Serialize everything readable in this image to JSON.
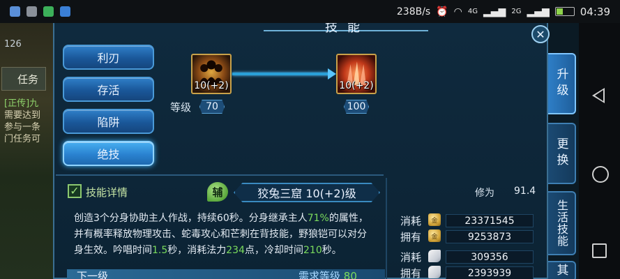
{
  "status_bar": {
    "net_speed": "238B/s",
    "battery": "9",
    "time": "04:39",
    "signal_1": "4G",
    "signal_2": "2G"
  },
  "background_hud": {
    "number": "126",
    "task_button": "任务",
    "task_lines": [
      "[正传]九",
      "需要达到",
      "参与一条",
      "门任务可"
    ]
  },
  "panel": {
    "title": "技能",
    "close_label": "✕"
  },
  "tabs": [
    {
      "label": "利刃",
      "active": false
    },
    {
      "label": "存活",
      "active": false
    },
    {
      "label": "陷阱",
      "active": false
    },
    {
      "label": "绝技",
      "active": true
    }
  ],
  "upgrade": {
    "level_label": "等级",
    "current": {
      "icon_level": "10(+2)",
      "level": "70"
    },
    "next": {
      "icon_level": "10(+2)",
      "level": "100"
    }
  },
  "details": {
    "header": "技能详情",
    "aux_badge": "辅",
    "skill_name": "狡兔三窟 10(+2)级",
    "desc_parts": [
      "创造3个分身协助主人作战，持续60秒。分身继承主人",
      "71%",
      "的属性，并有概率释放物理攻击、蛇毒攻心和芒刺在背技能，野狼铠可以对分身生效。吟唱时间",
      "1.5",
      "秒，消耗法力",
      "234",
      "点，冷却时间",
      "210",
      "秒。"
    ],
    "next_label": "下一级",
    "req_label": "需求等级",
    "req_value": "80"
  },
  "stats": {
    "xiuwei_label": "修为",
    "xiuwei_value": "91.4",
    "rows": [
      {
        "label": "消耗",
        "value": "23371545",
        "icon": "gold-coin-icon"
      },
      {
        "label": "拥有",
        "value": "9253873",
        "icon": "gold-coin-icon"
      },
      {
        "label": "消耗",
        "value": "309356",
        "icon": "scroll-icon"
      },
      {
        "label": "拥有",
        "value": "2393939",
        "icon": "scroll-icon"
      }
    ]
  },
  "side_tabs": [
    {
      "label": "升级",
      "active": true
    },
    {
      "label": "更换",
      "active": false
    },
    {
      "label": "生活技能",
      "active": false
    },
    {
      "label": "其",
      "active": false
    }
  ]
}
